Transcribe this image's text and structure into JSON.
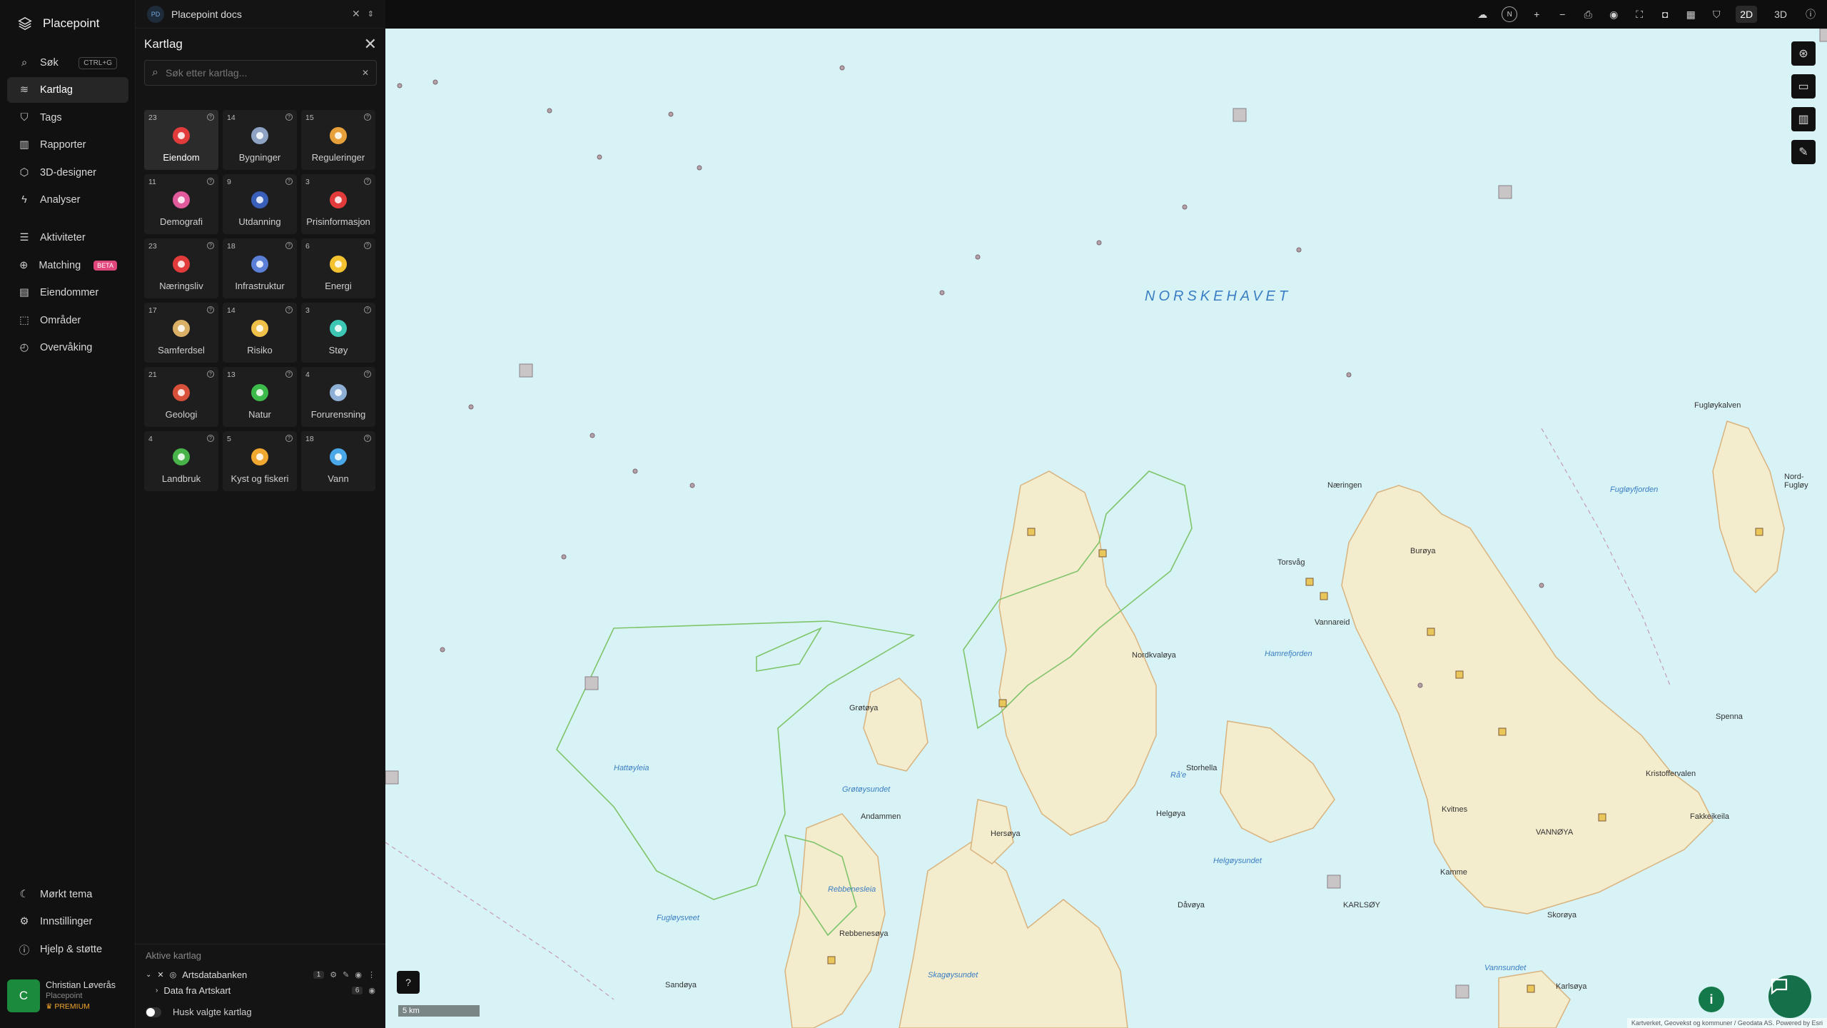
{
  "brand": {
    "name": "Placepoint"
  },
  "nav": {
    "items": [
      {
        "label": "Søk",
        "shortcut": "CTRL+G",
        "icon": "search-icon"
      },
      {
        "label": "Kartlag",
        "icon": "layers-icon",
        "active": true
      },
      {
        "label": "Tags",
        "icon": "bookmark-icon"
      },
      {
        "label": "Rapporter",
        "icon": "bar-chart-icon"
      },
      {
        "label": "3D-designer",
        "icon": "cube-icon"
      },
      {
        "label": "Analyser",
        "icon": "bolt-icon"
      },
      {
        "label": "Aktiviteter",
        "icon": "activity-icon"
      },
      {
        "label": "Matching",
        "badge": "BETA",
        "icon": "match-icon"
      },
      {
        "label": "Eiendommer",
        "icon": "building-icon"
      },
      {
        "label": "Områder",
        "icon": "area-icon"
      },
      {
        "label": "Overvåking",
        "icon": "monitor-icon"
      }
    ],
    "bottom": [
      {
        "label": "Mørkt tema",
        "icon": "moon-icon"
      },
      {
        "label": "Innstillinger",
        "icon": "gear-icon"
      },
      {
        "label": "Hjelp & støtte",
        "icon": "help-icon"
      }
    ]
  },
  "user": {
    "initial": "C",
    "name": "Christian Løverås",
    "org": "Placepoint",
    "plan": "PREMIUM"
  },
  "doc": {
    "badge": "PD",
    "title": "Placepoint docs"
  },
  "panel": {
    "title": "Kartlag",
    "search_placeholder": "Søk etter kartlag...",
    "tiles": [
      {
        "count": "23",
        "label": "Eiendom",
        "icon": "property-pin-icon",
        "color": "#e23b3b",
        "active": true
      },
      {
        "count": "14",
        "label": "Bygninger",
        "icon": "buildings-icon",
        "color": "#8ea3c4"
      },
      {
        "count": "15",
        "label": "Reguleringer",
        "icon": "regulation-sign-icon",
        "color": "#e8a13a"
      },
      {
        "count": "11",
        "label": "Demografi",
        "icon": "demography-icon",
        "color": "#e05a9c"
      },
      {
        "count": "9",
        "label": "Utdanning",
        "icon": "graduation-cap-icon",
        "color": "#3a5fb8"
      },
      {
        "count": "3",
        "label": "Prisinformasjon",
        "icon": "price-bag-icon",
        "color": "#e23b3b"
      },
      {
        "count": "23",
        "label": "Næringsliv",
        "icon": "shopping-bag-icon",
        "color": "#e23b3b"
      },
      {
        "count": "18",
        "label": "Infrastruktur",
        "icon": "globe-icon",
        "color": "#5b7fd6"
      },
      {
        "count": "6",
        "label": "Energi",
        "icon": "lightning-icon",
        "color": "#f2c230"
      },
      {
        "count": "17",
        "label": "Samferdsel",
        "icon": "bus-icon",
        "color": "#d9b066"
      },
      {
        "count": "14",
        "label": "Risiko",
        "icon": "risk-gauge-icon",
        "color": "#f0c04a"
      },
      {
        "count": "3",
        "label": "Støy",
        "icon": "noise-gauge-icon",
        "color": "#3ec6b5"
      },
      {
        "count": "21",
        "label": "Geologi",
        "icon": "geology-icon",
        "color": "#d9503a"
      },
      {
        "count": "13",
        "label": "Natur",
        "icon": "leaf-icon",
        "color": "#3cba4a"
      },
      {
        "count": "4",
        "label": "Forurensning",
        "icon": "factory-icon",
        "color": "#8fb0d6"
      },
      {
        "count": "4",
        "label": "Landbruk",
        "icon": "sprout-icon",
        "color": "#47b349"
      },
      {
        "count": "5",
        "label": "Kyst og fiskeri",
        "icon": "fish-icon",
        "color": "#f0a830"
      },
      {
        "count": "18",
        "label": "Vann",
        "icon": "water-drop-icon",
        "color": "#4aa8e8"
      }
    ],
    "active_layers": {
      "title": "Aktive kartlag",
      "group": {
        "name": "Artsdatabanken",
        "count": "1"
      },
      "child": {
        "name": "Data fra Artskart",
        "count": "6"
      }
    },
    "remember_label": "Husk valgte kartlag"
  },
  "toolbar": {
    "mode_2d": "2D",
    "mode_3d": "3D",
    "compass": "N"
  },
  "map": {
    "sea": "NORSKEHAVET",
    "places": [
      {
        "name": "Fugløykalven"
      },
      {
        "name": "Nord-Fugløy"
      },
      {
        "name": "Næringen"
      },
      {
        "name": "Torsvåg"
      },
      {
        "name": "Burøya"
      },
      {
        "name": "Vannareid"
      },
      {
        "name": "Grøtøya"
      },
      {
        "name": "Nordkvaløya"
      },
      {
        "name": "Storhella"
      },
      {
        "name": "Helgøya"
      },
      {
        "name": "Andammen"
      },
      {
        "name": "Rebbenesøya"
      },
      {
        "name": "Dåvøya"
      },
      {
        "name": "KARLSØY"
      },
      {
        "name": "VANNØYA"
      },
      {
        "name": "Kristoffervalen"
      },
      {
        "name": "Fakkeikeila"
      },
      {
        "name": "Sandøya"
      },
      {
        "name": "Kamme"
      },
      {
        "name": "Hersøya"
      },
      {
        "name": "Kvitnes"
      },
      {
        "name": "Spenna"
      },
      {
        "name": "Skorøya"
      },
      {
        "name": "Karlsøya"
      }
    ],
    "waters": [
      {
        "name": "Hattøyleia"
      },
      {
        "name": "Grøtøysundet"
      },
      {
        "name": "Fugløysveet"
      },
      {
        "name": "Skagøysundet"
      },
      {
        "name": "Rebbenesleia"
      },
      {
        "name": "Helgøysundet"
      },
      {
        "name": "Vannsundet"
      },
      {
        "name": "Fugløyfjorden"
      },
      {
        "name": "Hamrefjorden"
      },
      {
        "name": "Rå'e"
      }
    ],
    "scale_label": "5 km",
    "attribution": "Kartverket, Geovekst og kommuner / Geodata AS. Powered by Esri"
  }
}
